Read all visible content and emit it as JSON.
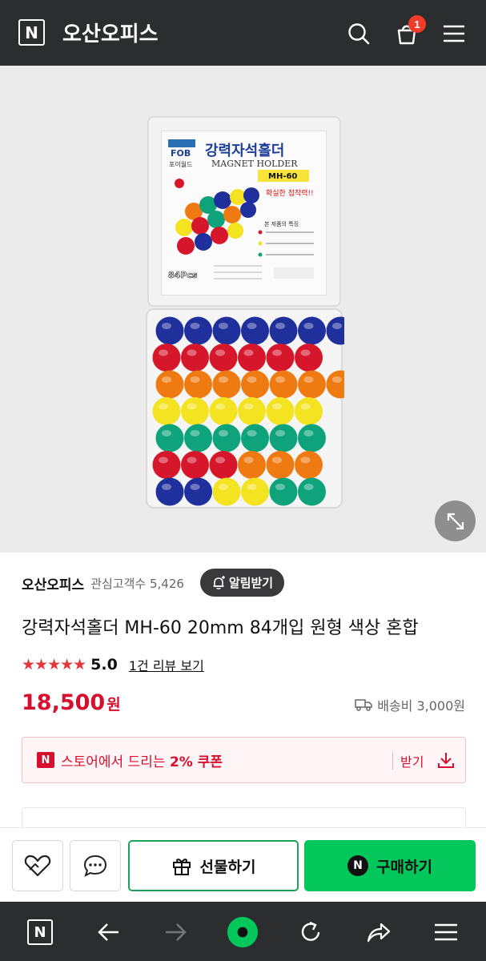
{
  "header": {
    "logo_letter": "N",
    "store_name": "오산오피스",
    "cart_count": "1",
    "icons": [
      "search-icon",
      "cart-icon",
      "menu-icon"
    ]
  },
  "product": {
    "image_alt": "강력자석홀더 MAGNET HOLDER MH-60",
    "packaging": {
      "title_ko": "강력자석홀더",
      "title_en": "MAGNET HOLDER",
      "model": "MH-60",
      "brand": "FOB",
      "brand_ko": "포이월드",
      "slogan": "확실한 접착력!!",
      "feature_title": "본 제품의 특징",
      "count": "84Pcs"
    },
    "magnet_colors": {
      "blue": "#1f2f9c",
      "red": "#d6162b",
      "orange": "#f07a12",
      "yellow": "#f4e320",
      "green": "#0ea37a"
    }
  },
  "seller": {
    "name": "오산오피스",
    "fans_label": "관심고객수 5,426",
    "alarm_label": "알림받기"
  },
  "title": "강력자석홀더 MH-60 20mm 84개입 원형 색상 혼합",
  "rating": {
    "stars": "★★★★★",
    "value": "5.0",
    "review_link": "1건 리뷰 보기"
  },
  "price": {
    "amount": "18,500",
    "unit": "원"
  },
  "shipping": {
    "label": "배송비 3,000원"
  },
  "coupon": {
    "badge": "N",
    "text_prefix": "스토어에서 드리는 ",
    "text_bold": "2% 쿠폰",
    "action": "받기"
  },
  "buy_bar": {
    "gift_label": "선물하기",
    "buy_label": "구매하기",
    "buy_badge": "N"
  },
  "colors": {
    "header_bg": "#2c2d2f",
    "price_red": "#d70f2e",
    "naver_green": "#03c75a"
  },
  "browser_nav": {
    "logo_letter": "N",
    "icons": [
      "home-n-icon",
      "back-arrow-icon",
      "forward-arrow-icon",
      "green-dot-icon",
      "refresh-icon",
      "share-icon",
      "menu-icon"
    ]
  }
}
